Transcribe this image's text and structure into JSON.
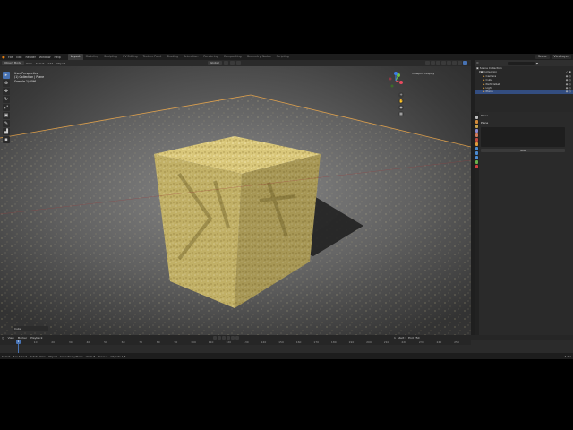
{
  "topbar": {
    "menus": [
      "File",
      "Edit",
      "Render",
      "Window",
      "Help"
    ],
    "workspaces": [
      "Layout",
      "Modeling",
      "Sculpting",
      "UV Editing",
      "Texture Paint",
      "Shading",
      "Animation",
      "Rendering",
      "Compositing",
      "Geometry Nodes",
      "Scripting"
    ],
    "active_workspace": "Layout",
    "scene": "Scene",
    "view_layer": "ViewLayer"
  },
  "viewport_header": {
    "mode": "Object Mode",
    "menus": [
      "View",
      "Select",
      "Add",
      "Object"
    ],
    "transform": "Global",
    "overlay_label": "Viewport Display"
  },
  "viewport_info": {
    "line1": "User Perspective",
    "line2": "(1) Collection | Plane",
    "line3": "Sample 1/4096"
  },
  "gizmo": {
    "x_color": "#e84a5f",
    "y_color": "#6fc342",
    "z_color": "#3c7ee8"
  },
  "toolbar": {
    "tools": [
      "select-icon",
      "cursor-icon",
      "move-icon",
      "rotate-icon",
      "scale-icon",
      "transform-icon",
      "annotate-icon",
      "measure-icon",
      "add-cube-icon"
    ]
  },
  "operator_panel": "Cube",
  "outliner": {
    "title": "Scene Collection",
    "rows": [
      {
        "label": "Collection",
        "indent": 1,
        "selected": false
      },
      {
        "label": "Camera",
        "indent": 2,
        "selected": false
      },
      {
        "label": "Cube",
        "indent": 2,
        "selected": false
      },
      {
        "label": "ParticleSet",
        "indent": 2,
        "selected": false
      },
      {
        "label": "Light",
        "indent": 2,
        "selected": false
      },
      {
        "label": "Plane",
        "indent": 2,
        "selected": true
      }
    ]
  },
  "properties": {
    "object": "Plane",
    "section": "Plane",
    "slot_label": "New"
  },
  "timeline": {
    "menus": [
      "View",
      "Marker",
      "Playback"
    ],
    "ticks": [
      "0",
      "10",
      "20",
      "30",
      "40",
      "50",
      "60",
      "70",
      "80",
      "90",
      "100",
      "110",
      "120",
      "130",
      "140",
      "150",
      "160",
      "170",
      "180",
      "190",
      "200",
      "210",
      "220",
      "230",
      "240",
      "250"
    ],
    "current_frame": "1",
    "start": "Start 1",
    "end": "End 250"
  },
  "statusbar": {
    "items": [
      "Select",
      "Box Select",
      "Rotate View",
      "Object",
      "Collection | Plane",
      "Verts 8",
      "Faces 6",
      "Objects 1/5"
    ],
    "version": "3.4.1"
  }
}
